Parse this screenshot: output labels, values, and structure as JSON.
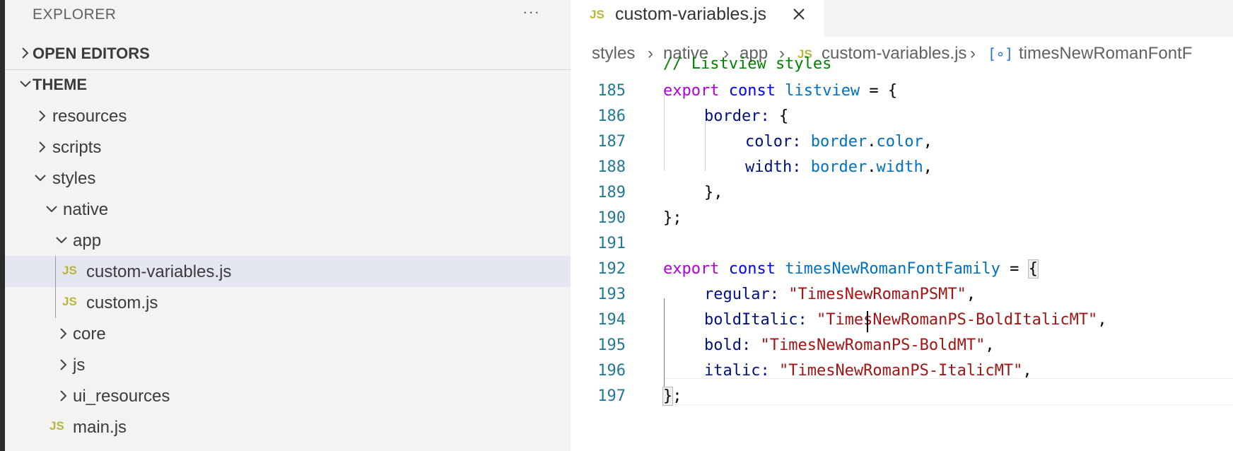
{
  "explorer": {
    "title": "EXPLORER",
    "more": "···",
    "open_editors": "OPEN EDITORS",
    "root": "THEME",
    "tree": [
      {
        "name": "resources"
      },
      {
        "name": "scripts"
      },
      {
        "name": "styles"
      },
      {
        "name": "native"
      },
      {
        "name": "app"
      },
      {
        "name": "custom-variables.js",
        "selected": true
      },
      {
        "name": "custom.js"
      },
      {
        "name": "core"
      },
      {
        "name": "js"
      },
      {
        "name": "ui_resources"
      },
      {
        "name": "main.js"
      }
    ]
  },
  "file_icon_label": "JS",
  "tab": {
    "label": "custom-variables.js"
  },
  "breadcrumb": {
    "items": [
      "styles",
      "native",
      "app",
      "custom-variables.js",
      "timesNewRomanFontF"
    ],
    "sep": "›",
    "symbol_icon": "[∘]"
  },
  "code": {
    "partial_comment": "// Listview styles",
    "lines": [
      {
        "n": "185"
      },
      {
        "n": "186"
      },
      {
        "n": "187"
      },
      {
        "n": "188"
      },
      {
        "n": "189"
      },
      {
        "n": "190"
      },
      {
        "n": "191"
      },
      {
        "n": "192"
      },
      {
        "n": "193"
      },
      {
        "n": "194"
      },
      {
        "n": "195"
      },
      {
        "n": "196"
      },
      {
        "n": "197"
      }
    ],
    "tokens": {
      "export": "export",
      "const": "const",
      "listview": "listview",
      "assign_open": " = {",
      "border_key": "border:",
      "open_brace": " {",
      "color_key": "color:",
      "border_obj": "border",
      "dot": ".",
      "color_prop": "color",
      "comma": ",",
      "width_key": "width:",
      "width_prop": "width",
      "close_inner": "},",
      "close_outer": "};",
      "times_name": "timesNewRomanFontFamily",
      "assign_eq": " = ",
      "brace_open": "{",
      "regular_key": "regular:",
      "regular_val": "\"TimesNewRomanPSMT\"",
      "bolditalic_key": "boldItalic:",
      "bolditalic_val": "\"TimesNewRomanPS-BoldItalicMT\"",
      "bold_key": "bold:",
      "bold_val": "\"TimesNewRomanPS-BoldMT\"",
      "italic_key": "italic:",
      "italic_val": "\"TimesNewRomanPS-ItalicMT\"",
      "brace_close": "}",
      "semi": ";"
    }
  }
}
